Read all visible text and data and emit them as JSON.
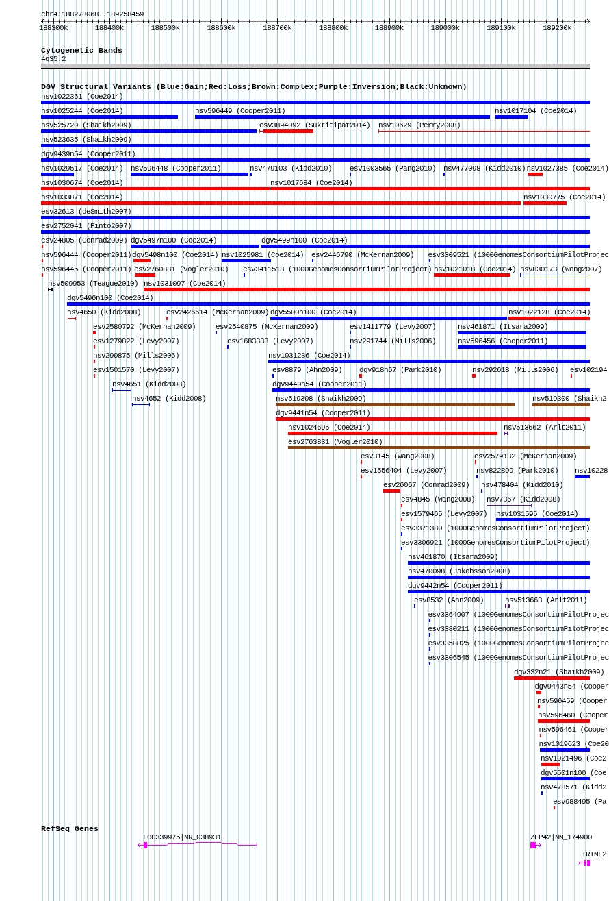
{
  "ruler": {
    "position": "chr4:188278068..189258459",
    "ticks": [
      "188300k",
      "188400k",
      "188500k",
      "188600k",
      "188700k",
      "188800k",
      "188900k",
      "189000k",
      "189100k",
      "189200k"
    ]
  },
  "cytoband_track": {
    "title": "Cytogenetic Bands",
    "bands": [
      {
        "label": "4q35.2"
      }
    ]
  },
  "variant_track": {
    "title": "DGV Structural Variants (Blue:Gain;Red:Loss;Brown:Complex;Purple:Inversion;Black:Unknown)",
    "rows": [
      {
        "features": [
          {
            "label": "nsv1022361 (Coe2014)",
            "color": "#0000ff",
            "kind": "bar"
          }
        ]
      },
      {
        "features": [
          {
            "label": "nsv1025244 (Coe2014)",
            "color": "#0000ff",
            "kind": "bar"
          },
          {
            "label": "nsv596449 (Cooper2011)",
            "color": "#0000ff",
            "kind": "bar"
          },
          {
            "label": "nsv1017104 (Coe2014)",
            "color": "#0000ff",
            "kind": "bar"
          }
        ]
      },
      {
        "features": [
          {
            "label": "nsv525720 (Shaikh2009)",
            "color": "#0000ff",
            "kind": "bar"
          },
          {
            "label": "esv3894092 (Suktitipat2014)",
            "color": "#ff0000",
            "kind": "bar"
          },
          {
            "label": "nsv10629 (Perry2008)",
            "color": "#ff0000",
            "kind": "span"
          }
        ]
      },
      {
        "features": [
          {
            "label": "nsv523635 (Shaikh2009)",
            "color": "#0000ff",
            "kind": "bar"
          }
        ]
      },
      {
        "features": [
          {
            "label": "dgv9439n54 (Cooper2011)",
            "color": "#0000ff",
            "kind": "bar"
          }
        ]
      },
      {
        "features": [
          {
            "label": "nsv1029517 (Coe2014)",
            "color": "#0000ff",
            "kind": "bar"
          },
          {
            "label": "nsv596448 (Cooper2011)",
            "color": "#0000ff",
            "kind": "bar"
          },
          {
            "label": "nsv479103 (Kidd2010)",
            "color": "#0000ff",
            "kind": "bar"
          },
          {
            "label": "esv1003565 (Pang2010)",
            "color": "#0000ff",
            "kind": "bar"
          },
          {
            "label": "nsv477098 (Kidd2010)",
            "color": "#0000ff",
            "kind": "bar"
          },
          {
            "label": "nsv1027385 (Coe2014)",
            "color": "#ff0000",
            "kind": "bar"
          }
        ]
      },
      {
        "features": [
          {
            "label": "nsv1030674 (Coe2014)",
            "color": "#ff0000",
            "kind": "bar"
          },
          {
            "label": "nsv1017684 (Coe2014)",
            "color": "#ff0000",
            "kind": "bar"
          }
        ]
      },
      {
        "features": [
          {
            "label": "nsv1033871 (Coe2014)",
            "color": "#ff0000",
            "kind": "bar"
          },
          {
            "label": "nsv1030775 (Coe2014)",
            "color": "#ff0000",
            "kind": "bar"
          }
        ]
      },
      {
        "features": [
          {
            "label": "esv32613 (deSmith2007)",
            "color": "#0000ff",
            "kind": "bar"
          }
        ]
      },
      {
        "features": [
          {
            "label": "esv2752041 (Pinto2007)",
            "color": "#0000ff",
            "kind": "bar"
          }
        ]
      },
      {
        "features": [
          {
            "label": "esv24805 (Conrad2009)",
            "color": "#ff0000",
            "kind": "bar"
          },
          {
            "label": "dgv5497n100 (Coe2014)",
            "color": "#0000ff",
            "kind": "bar"
          },
          {
            "label": "dgv5499n100 (Coe2014)",
            "color": "#0000ff",
            "kind": "bar"
          }
        ]
      },
      {
        "features": [
          {
            "label": "nsv596444 (Cooper2011)",
            "color": "#ff0000",
            "kind": "bar"
          },
          {
            "label": "dgv5498n100 (Coe2014)",
            "color": "#ff0000",
            "kind": "bar"
          },
          {
            "label": "nsv1025981 (Coe2014)",
            "color": "#0000ff",
            "kind": "bar"
          },
          {
            "label": "esv2446790 (McKernan2009)",
            "color": "#0000ff",
            "kind": "bar"
          },
          {
            "label": "esv3309521 (1000GenomesConsortiumPilotProjec",
            "color": "#0000ff",
            "kind": "bar"
          }
        ]
      },
      {
        "features": [
          {
            "label": "nsv596445 (Cooper2011)",
            "color": "#ff0000",
            "kind": "bar"
          },
          {
            "label": "esv2760881 (Vogler2010)",
            "color": "#ff0000",
            "kind": "bar"
          },
          {
            "label": "esv3411518 (1000GenomesConsortiumPilotProject)",
            "color": "#0000ff",
            "kind": "bar"
          },
          {
            "label": "nsv1021018 (Coe2014)",
            "color": "#ff0000",
            "kind": "bar"
          },
          {
            "label": "nsv830173 (Wong2007)",
            "color": "#0000ff",
            "kind": "span"
          }
        ]
      },
      {
        "features": [
          {
            "label": "nsv509953 (Teague2010)",
            "color": "#000000",
            "kind": "span"
          },
          {
            "label": "nsv1031097 (Coe2014)",
            "color": "#ff0000",
            "kind": "bar"
          }
        ]
      },
      {
        "features": [
          {
            "label": "dgv5496n100 (Coe2014)",
            "color": "#0000ff",
            "kind": "bar"
          }
        ]
      },
      {
        "features": [
          {
            "label": "nsv4650 (Kidd2008)",
            "color": "#ff0000",
            "kind": "span"
          },
          {
            "label": "esv2426614 (McKernan2009)",
            "color": "#ff0000",
            "kind": "bar"
          },
          {
            "label": "dgv5500n100 (Coe2014)",
            "color": "#0000ff",
            "kind": "bar"
          },
          {
            "label": "nsv1022128 (Coe2014)",
            "color": "#ff0000",
            "kind": "bar"
          }
        ]
      },
      {
        "features": [
          {
            "label": "esv2580792 (McKernan2009)",
            "color": "#ff0000",
            "kind": "bar"
          },
          {
            "label": "esv2540875 (McKernan2009)",
            "color": "#0000ff",
            "kind": "bar"
          },
          {
            "label": "esv1411779 (Levy2007)",
            "color": "#0000ff",
            "kind": "bar"
          },
          {
            "label": "nsv461871 (Itsara2009)",
            "color": "#0000ff",
            "kind": "bar"
          }
        ]
      },
      {
        "features": [
          {
            "label": "esv1279822 (Levy2007)",
            "color": "#ff0000",
            "kind": "bar"
          },
          {
            "label": "esv1683383 (Levy2007)",
            "color": "#0000ff",
            "kind": "bar"
          },
          {
            "label": "nsv291744 (Mills2006)",
            "color": "#0000ff",
            "kind": "bar"
          },
          {
            "label": "nsv596456 (Cooper2011)",
            "color": "#0000ff",
            "kind": "bar"
          }
        ]
      },
      {
        "features": [
          {
            "label": "nsv290875 (Mills2006)",
            "color": "#ff0000",
            "kind": "bar"
          },
          {
            "label": "nsv1031236 (Coe2014)",
            "color": "#0000ff",
            "kind": "bar"
          }
        ]
      },
      {
        "features": [
          {
            "label": "esv1501570 (Levy2007)",
            "color": "#ff0000",
            "kind": "bar"
          },
          {
            "label": "esv8879 (Ahn2009)",
            "color": "#0000ff",
            "kind": "bar"
          },
          {
            "label": "dgv918n67 (Park2010)",
            "color": "#ff0000",
            "kind": "bar"
          },
          {
            "label": "nsv292618 (Mills2006)",
            "color": "#ff0000",
            "kind": "bar"
          },
          {
            "label": "esv102194",
            "color": "#ff0000",
            "kind": "bar"
          }
        ]
      },
      {
        "features": [
          {
            "label": "nsv4651 (Kidd2008)",
            "color": "#0000ff",
            "kind": "span"
          },
          {
            "label": "dgv9440n54 (Cooper2011)",
            "color": "#0000ff",
            "kind": "bar"
          }
        ]
      },
      {
        "features": [
          {
            "label": "nsv4652 (Kidd2008)",
            "color": "#0000ff",
            "kind": "span"
          },
          {
            "label": "nsv519308 (Shaikh2009)",
            "color": "#8b4513",
            "kind": "bar"
          },
          {
            "label": "nsv519300 (Shaikh2",
            "color": "#8b4513",
            "kind": "bar"
          }
        ]
      },
      {
        "features": [
          {
            "label": "dgv9441n54 (Cooper2011)",
            "color": "#ff0000",
            "kind": "bar"
          }
        ]
      },
      {
        "features": [
          {
            "label": "nsv1024695 (Coe2014)",
            "color": "#ff0000",
            "kind": "bar"
          },
          {
            "label": "nsv513662 (Arlt2011)",
            "color": "#551a8b",
            "kind": "span"
          }
        ]
      },
      {
        "features": [
          {
            "label": "esv2763831 (Vogler2010)",
            "color": "#8b4513",
            "kind": "bar"
          }
        ]
      },
      {
        "features": [
          {
            "label": "esv3145 (Wang2008)",
            "color": "#ff0000",
            "kind": "bar"
          },
          {
            "label": "esv2579132 (McKernan2009)",
            "color": "#ff0000",
            "kind": "bar"
          }
        ]
      },
      {
        "features": [
          {
            "label": "esv1556404 (Levy2007)",
            "color": "#ff0000",
            "kind": "bar"
          },
          {
            "label": "nsv822899 (Park2010)",
            "color": "#0000ff",
            "kind": "bar"
          },
          {
            "label": "nsv10228",
            "color": "#0000ff",
            "kind": "bar"
          }
        ]
      },
      {
        "features": [
          {
            "label": "esv26067 (Conrad2009)",
            "color": "#ff0000",
            "kind": "bar"
          },
          {
            "label": "nsv478404 (Kidd2010)",
            "color": "#0000ff",
            "kind": "bar"
          }
        ]
      },
      {
        "features": [
          {
            "label": "esv4845 (Wang2008)",
            "color": "#ff0000",
            "kind": "bar"
          },
          {
            "label": "nsv7367 (Kidd2008)",
            "color": "#551a8b",
            "kind": "span"
          }
        ]
      },
      {
        "features": [
          {
            "label": "esv1579465 (Levy2007)",
            "color": "#ff0000",
            "kind": "bar"
          },
          {
            "label": "nsv1031595 (Coe2014)",
            "color": "#0000ff",
            "kind": "bar"
          }
        ]
      },
      {
        "features": [
          {
            "label": "esv3371380 (1000GenomesConsortiumPilotProject)",
            "color": "#0000ff",
            "kind": "bar"
          }
        ]
      },
      {
        "features": [
          {
            "label": "esv3306921 (1000GenomesConsortiumPilotProject)",
            "color": "#0000ff",
            "kind": "bar"
          }
        ]
      },
      {
        "features": [
          {
            "label": "nsv461870 (Itsara2009)",
            "color": "#0000ff",
            "kind": "bar"
          }
        ]
      },
      {
        "features": [
          {
            "label": "nsv470098 (Jakobsson2008)",
            "color": "#0000ff",
            "kind": "bar"
          }
        ]
      },
      {
        "features": [
          {
            "label": "dgv9442n54 (Cooper2011)",
            "color": "#0000ff",
            "kind": "bar"
          }
        ]
      },
      {
        "features": [
          {
            "label": "esv8532 (Ahn2009)",
            "color": "#0000ff",
            "kind": "bar"
          },
          {
            "label": "nsv513663 (Arlt2011)",
            "color": "#551a8b",
            "kind": "span"
          }
        ]
      },
      {
        "features": [
          {
            "label": "esv3364907 (1000GenomesConsortiumPilotProjec",
            "color": "#0000ff",
            "kind": "bar"
          }
        ]
      },
      {
        "features": [
          {
            "label": "esv3380211 (1000GenomesConsortiumPilotProjec",
            "color": "#0000ff",
            "kind": "bar"
          }
        ]
      },
      {
        "features": [
          {
            "label": "esv3358825 (1000GenomesConsortiumPilotProjec",
            "color": "#0000ff",
            "kind": "bar"
          }
        ]
      },
      {
        "features": [
          {
            "label": "esv3306545 (1000GenomesConsortiumPilotProjec",
            "color": "#0000ff",
            "kind": "bar"
          }
        ]
      },
      {
        "features": [
          {
            "label": "dgv332n21 (Shaikh2009)",
            "color": "#ff0000",
            "kind": "bar"
          }
        ]
      },
      {
        "features": [
          {
            "label": "dgv9443n54 (Cooper",
            "color": "#ff0000",
            "kind": "bar"
          }
        ]
      },
      {
        "features": [
          {
            "label": "nsv596459 (Cooper",
            "color": "#ff0000",
            "kind": "bar"
          }
        ]
      },
      {
        "features": [
          {
            "label": "nsv596460 (Cooper",
            "color": "#ff0000",
            "kind": "bar"
          }
        ]
      },
      {
        "features": [
          {
            "label": "nsv596461 (Cooper",
            "color": "#ff0000",
            "kind": "bar"
          }
        ]
      },
      {
        "features": [
          {
            "label": "nsv1019623 (Coe20",
            "color": "#0000ff",
            "kind": "bar"
          }
        ]
      },
      {
        "features": [
          {
            "label": "nsv1021496 (Coe2",
            "color": "#ff0000",
            "kind": "bar"
          }
        ]
      },
      {
        "features": [
          {
            "label": "dgv5501n100 (Coe",
            "color": "#0000ff",
            "kind": "bar"
          }
        ]
      },
      {
        "features": [
          {
            "label": "nsv478571 (Kidd2",
            "color": "#0000ff",
            "kind": "bar"
          }
        ]
      },
      {
        "features": [
          {
            "label": "esv988495 (Pa",
            "color": "#ff0000",
            "kind": "bar"
          }
        ]
      }
    ]
  },
  "gene_track": {
    "title": "RefSeq Genes",
    "genes": [
      {
        "label": "LOC339975|NR_038931",
        "reverse": true
      },
      {
        "label": "ZFP42|NM_174900",
        "reverse": false
      },
      {
        "label": "TRIML2",
        "reverse": true
      }
    ]
  }
}
